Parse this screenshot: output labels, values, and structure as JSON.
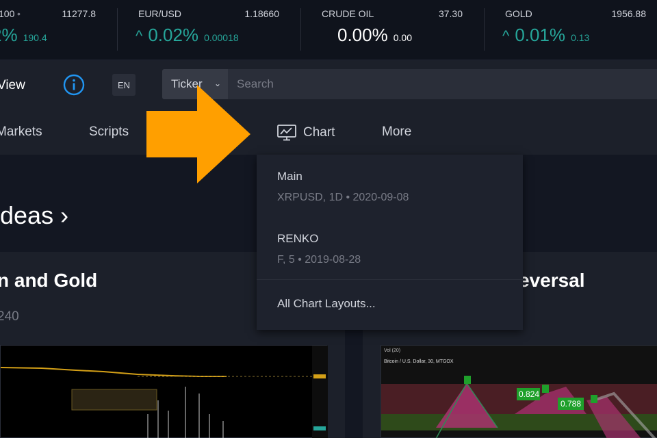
{
  "tickers": [
    {
      "name": "100",
      "price": "11277.8",
      "pct": "2%",
      "abs": "190.4",
      "dir": "up",
      "arrow": "",
      "dot": "•"
    },
    {
      "name": "EUR/USD",
      "price": "1.18660",
      "pct": "0.02%",
      "abs": "0.00018",
      "dir": "up",
      "arrow": "^"
    },
    {
      "name": "CRUDE OIL",
      "price": "37.30",
      "pct": "0.00%",
      "abs": "0.00",
      "dir": "flat",
      "arrow": ""
    },
    {
      "name": "GOLD",
      "price": "1956.88",
      "pct": "0.01%",
      "abs": "0.13",
      "dir": "up",
      "arrow": "^"
    }
  ],
  "header": {
    "logo_text": "View",
    "lang": "EN",
    "ticker_label": "Ticker",
    "search_placeholder": "Search"
  },
  "nav": {
    "markets": "Markets",
    "scripts": "Scripts",
    "chart": "Chart",
    "more": "More"
  },
  "dropdown": {
    "items": [
      {
        "name": "Main",
        "meta": "XRPUSD, 1D • 2020-09-08"
      },
      {
        "name": "RENKO",
        "meta": "F, 5 • 2019-08-28"
      }
    ],
    "all_layouts": "All Chart Layouts..."
  },
  "content": {
    "ideas_title": "ideas ›",
    "card1_title": "n and Gold",
    "card1_sub": "240",
    "card2_title": "eversal",
    "thumb2_caption": "Bitcoin / U.S. Dollar, 30, MTGOX",
    "thumb2_vol": "Vol (20)",
    "thumb2_labels": [
      "0.824",
      "0.788"
    ]
  },
  "colors": {
    "background": "#131722",
    "panel": "#1c202a",
    "up": "#26a69a",
    "accent_arrow": "#ff9f00",
    "info_blue": "#2196f3"
  }
}
